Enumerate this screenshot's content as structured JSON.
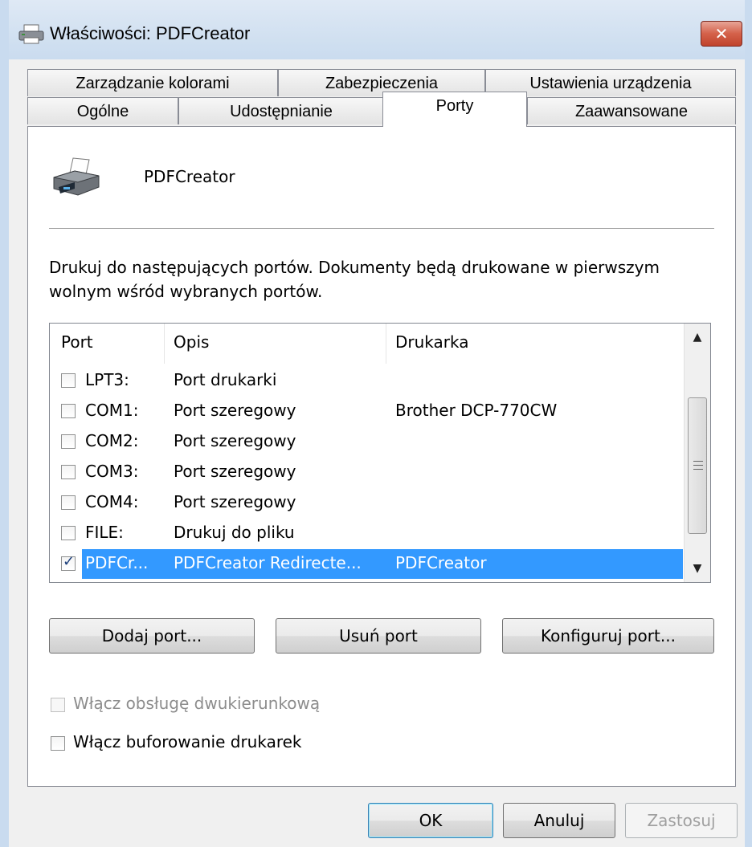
{
  "window": {
    "title": "Właściwości: PDFCreator",
    "title_icon": "printer-icon",
    "close_label": "✕"
  },
  "tabs": {
    "row1": [
      {
        "label": "Zarządzanie kolorami"
      },
      {
        "label": "Zabezpieczenia"
      },
      {
        "label": "Ustawienia urządzenia"
      }
    ],
    "row2": [
      {
        "label": "Ogólne"
      },
      {
        "label": "Udostępnianie"
      },
      {
        "label": "Porty",
        "active": true
      },
      {
        "label": "Zaawansowane"
      }
    ]
  },
  "printer": {
    "name": "PDFCreator",
    "icon": "printer-icon"
  },
  "description": "Drukuj do następujących portów. Dokumenty będą drukowane w pierwszym wolnym wśród wybranych portów.",
  "port_list": {
    "columns": [
      "Port",
      "Opis",
      "Drukarka"
    ],
    "rows": [
      {
        "port": "LPT3:",
        "desc": "Port drukarki",
        "printer": "",
        "checked": false
      },
      {
        "port": "COM1:",
        "desc": "Port szeregowy",
        "printer": "Brother DCP-770CW",
        "checked": false
      },
      {
        "port": "COM2:",
        "desc": "Port szeregowy",
        "printer": "",
        "checked": false
      },
      {
        "port": "COM3:",
        "desc": "Port szeregowy",
        "printer": "",
        "checked": false
      },
      {
        "port": "COM4:",
        "desc": "Port szeregowy",
        "printer": "",
        "checked": false
      },
      {
        "port": "FILE:",
        "desc": "Drukuj do pliku",
        "printer": "",
        "checked": false
      },
      {
        "port": "PDFCr...",
        "desc": "PDFCreator Redirecte...",
        "printer": "PDFCreator",
        "checked": true,
        "selected": true
      }
    ]
  },
  "port_buttons": {
    "add": "Dodaj port...",
    "delete": "Usuń port",
    "configure": "Konfiguruj port..."
  },
  "options": {
    "bidirectional": {
      "label": "Włącz obsługę dwukierunkową",
      "checked": false,
      "disabled": true
    },
    "pooling": {
      "label": "Włącz buforowanie drukarek",
      "checked": false,
      "disabled": false
    }
  },
  "footer": {
    "ok": "OK",
    "cancel": "Anuluj",
    "apply": "Zastosuj"
  }
}
